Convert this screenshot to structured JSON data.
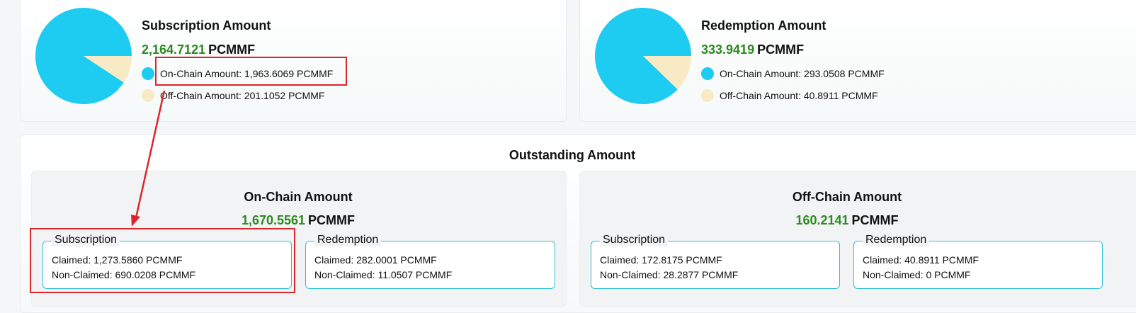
{
  "subscription_card": {
    "title": "Subscription Amount",
    "total_value": "2,164.7121",
    "unit": "PCMMF",
    "onchain_label": "On-Chain Amount: 1,963.6069 PCMMF",
    "offchain_label": "Off-Chain Amount: 201.1052 PCMMF",
    "onchain_share": 1963.6069,
    "offchain_share": 201.1052
  },
  "redemption_card": {
    "title": "Redemption Amount",
    "total_value": "333.9419",
    "unit": "PCMMF",
    "onchain_label": "On-Chain Amount: 293.0508 PCMMF",
    "offchain_label": "Off-Chain Amount: 40.8911 PCMMF",
    "onchain_share": 293.0508,
    "offchain_share": 40.8911
  },
  "outstanding": {
    "title": "Outstanding Amount",
    "onchain": {
      "title": "On-Chain Amount",
      "value": "1,670.5561",
      "unit": "PCMMF",
      "subscription": {
        "legend": "Subscription",
        "claimed": "Claimed: 1,273.5860 PCMMF",
        "non_claimed": "Non-Claimed: 690.0208 PCMMF"
      },
      "redemption": {
        "legend": "Redemption",
        "claimed": "Claimed: 282.0001 PCMMF",
        "non_claimed": "Non-Claimed: 11.0507 PCMMF"
      }
    },
    "offchain": {
      "title": "Off-Chain Amount",
      "value": "160.2141",
      "unit": "PCMMF",
      "subscription": {
        "legend": "Subscription",
        "claimed": "Claimed: 172.8175 PCMMF",
        "non_claimed": "Non-Claimed: 28.2877 PCMMF"
      },
      "redemption": {
        "legend": "Redemption",
        "claimed": "Claimed: 40.8911 PCMMF",
        "non_claimed": "Non-Claimed: 0 PCMMF"
      }
    }
  },
  "colors": {
    "onchain": "#1ecbf1",
    "offchain": "#f8eac5",
    "value_green": "#2a8a1f",
    "fieldset_border": "#2bbfd7",
    "annotation_red": "#d9262c"
  }
}
